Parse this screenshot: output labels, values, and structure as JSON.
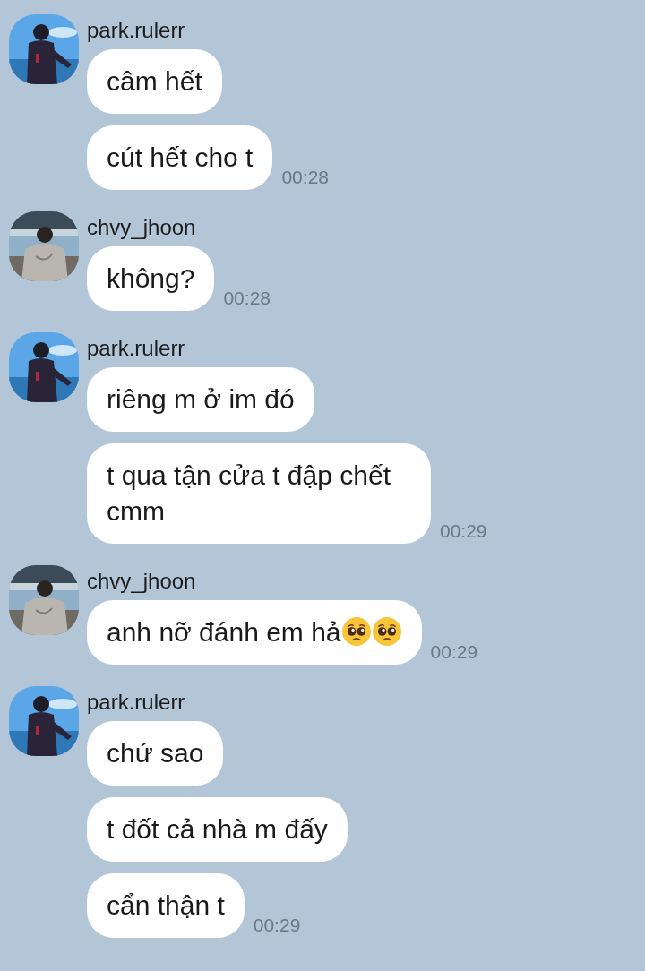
{
  "groups": [
    {
      "sender": "park.rulerr",
      "avatar": {
        "kind": "sky"
      },
      "messages": [
        {
          "text": "câm hết"
        },
        {
          "text": "cút hết cho t",
          "time": "00:28"
        }
      ]
    },
    {
      "sender": "chvy_jhoon",
      "avatar": {
        "kind": "station"
      },
      "messages": [
        {
          "text": "không?",
          "time": "00:28"
        }
      ]
    },
    {
      "sender": "park.rulerr",
      "avatar": {
        "kind": "sky"
      },
      "messages": [
        {
          "text": "riêng m ở im đó"
        },
        {
          "text": "t qua tận cửa t đập chết cmm",
          "time": "00:29"
        }
      ]
    },
    {
      "sender": "chvy_jhoon",
      "avatar": {
        "kind": "station"
      },
      "messages": [
        {
          "text": "anh nỡ đánh em hả",
          "emoji": [
            {
              "kind": "pleading"
            },
            {
              "kind": "pleading"
            }
          ],
          "time": "00:29"
        }
      ]
    },
    {
      "sender": "park.rulerr",
      "avatar": {
        "kind": "sky"
      },
      "messages": [
        {
          "text": "chứ sao"
        },
        {
          "text": "t đốt cả nhà m đấy"
        },
        {
          "text": "cẩn thận t",
          "time": "00:29"
        }
      ]
    }
  ]
}
